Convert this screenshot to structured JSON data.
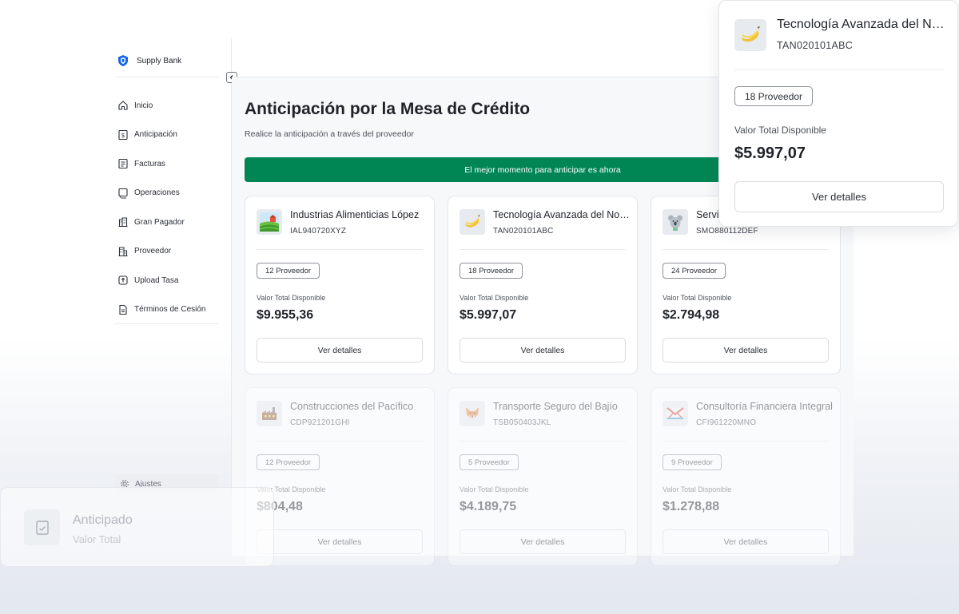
{
  "brand": {
    "name": "Supply Bank",
    "color": "#1565e6"
  },
  "sidebar": {
    "items": [
      {
        "label": "Inicio",
        "icon": "home-icon"
      },
      {
        "label": "Anticipación",
        "icon": "dollar-document-icon"
      },
      {
        "label": "Facturas",
        "icon": "invoice-icon"
      },
      {
        "label": "Operaciones",
        "icon": "operations-icon"
      },
      {
        "label": "Gran Pagador",
        "icon": "building-icon"
      },
      {
        "label": "Proveedor",
        "icon": "supplier-building-icon"
      },
      {
        "label": "Upload Tasa",
        "icon": "upload-rate-icon"
      },
      {
        "label": "Términos de Cesión",
        "icon": "terms-document-icon"
      }
    ],
    "settings_label": "Ajustes"
  },
  "main": {
    "title": "Anticipación por la Mesa de Crédito",
    "subtitle": "Realice la anticipación a través del proveedor",
    "banner": "El mejor momento para anticipar es ahora",
    "banner_color": "#008655"
  },
  "cards": [
    {
      "name": "Industrias Alimenticias López",
      "code": "IAL940720XYZ",
      "badge": "12 Proveedor",
      "label": "Valor Total Disponible",
      "value": "$9.955,36",
      "button": "Ver detalles",
      "icon": "farm-icon"
    },
    {
      "name": "Tecnología Avanzada del Norte",
      "code": "TAN020101ABC",
      "badge": "18 Proveedor",
      "label": "Valor Total Disponible",
      "value": "$5.997,07",
      "button": "Ver detalles",
      "icon": "banana-icon"
    },
    {
      "name": "Servicios Médicos de Occidente",
      "code": "SMO880112DEF",
      "badge": "24 Proveedor",
      "label": "Valor Total Disponible",
      "value": "$2.794,98",
      "button": "Ver detalles",
      "icon": "koala-icon"
    },
    {
      "name": "Construcciones del Pacífico",
      "code": "CDP921201GHI",
      "badge": "12 Proveedor",
      "label": "Valor Total Disponible",
      "value": "$804,48",
      "button": "Ver detalles",
      "icon": "factory-icon"
    },
    {
      "name": "Transporte Seguro del Bajío",
      "code": "TSB050403JKL",
      "badge": "5 Proveedor",
      "label": "Valor Total Disponible",
      "value": "$4.189,75",
      "button": "Ver detalles",
      "icon": "fox-icon"
    },
    {
      "name": "Consultoría Financiera Integral",
      "code": "CFI961220MNO",
      "badge": "9 Proveedor",
      "label": "Valor Total Disponible",
      "value": "$1.278,88",
      "button": "Ver detalles",
      "icon": "envelope-icon"
    }
  ],
  "popover": {
    "name": "Tecnología Avanzada del Norte",
    "code": "TAN020101ABC",
    "badge": "18 Proveedor",
    "label": "Valor Total Disponible",
    "value": "$5.997,07",
    "button": "Ver detalles",
    "icon": "banana-icon"
  },
  "float_card": {
    "title": "Anticipado",
    "subtitle": "Valor Total",
    "icon": "receipt-icon"
  }
}
